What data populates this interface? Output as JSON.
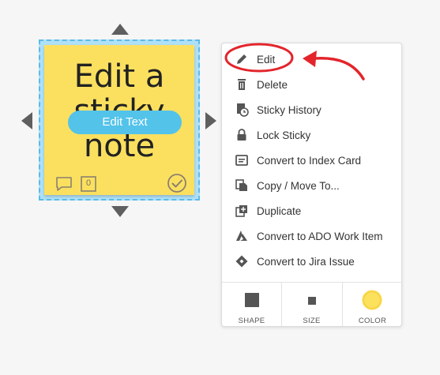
{
  "sticky": {
    "text": "Edit a sticky note",
    "edit_button_label": "Edit Text",
    "vote_count": "0",
    "color": "#fbe05f"
  },
  "menu": {
    "items": [
      {
        "label": "Edit",
        "icon": "pencil-icon"
      },
      {
        "label": "Delete",
        "icon": "trash-icon"
      },
      {
        "label": "Sticky History",
        "icon": "history-icon"
      },
      {
        "label": "Lock Sticky",
        "icon": "lock-icon"
      },
      {
        "label": "Convert to Index Card",
        "icon": "index-card-icon"
      },
      {
        "label": "Copy / Move To...",
        "icon": "copy-move-icon"
      },
      {
        "label": "Duplicate",
        "icon": "duplicate-icon"
      },
      {
        "label": "Convert to ADO Work Item",
        "icon": "azure-devops-icon"
      },
      {
        "label": "Convert to Jira Issue",
        "icon": "jira-icon"
      }
    ],
    "bottom": [
      {
        "label": "SHAPE",
        "icon": "shape-square-icon"
      },
      {
        "label": "SIZE",
        "icon": "size-square-icon"
      },
      {
        "label": "COLOR",
        "icon": "color-circle-icon"
      }
    ]
  },
  "colors": {
    "accent": "#53c3ea",
    "selection": "#5bbbe9",
    "annotation": "#e3242b",
    "icon": "#555555"
  }
}
